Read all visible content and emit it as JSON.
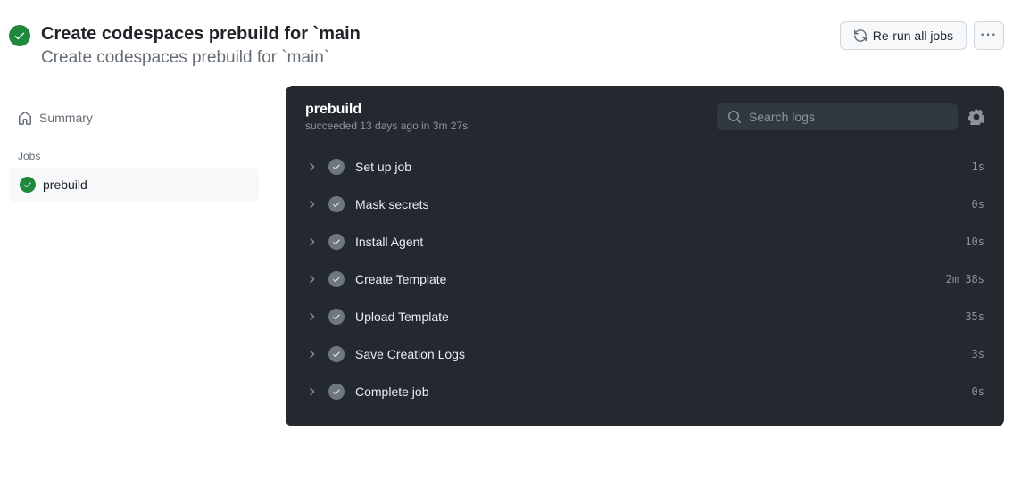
{
  "header": {
    "title": "Create codespaces prebuild for `main",
    "subtitle": "Create codespaces prebuild for `main`",
    "rerun_label": "Re-run all jobs"
  },
  "sidebar": {
    "summary_label": "Summary",
    "jobs_heading": "Jobs",
    "jobs": [
      {
        "name": "prebuild"
      }
    ]
  },
  "panel": {
    "title": "prebuild",
    "subtitle": "succeeded 13 days ago in 3m 27s",
    "search_placeholder": "Search logs",
    "steps": [
      {
        "label": "Set up job",
        "duration": "1s"
      },
      {
        "label": "Mask secrets",
        "duration": "0s"
      },
      {
        "label": "Install Agent",
        "duration": "10s"
      },
      {
        "label": "Create Template",
        "duration": "2m 38s"
      },
      {
        "label": "Upload Template",
        "duration": "35s"
      },
      {
        "label": "Save Creation Logs",
        "duration": "3s"
      },
      {
        "label": "Complete job",
        "duration": "0s"
      }
    ]
  }
}
